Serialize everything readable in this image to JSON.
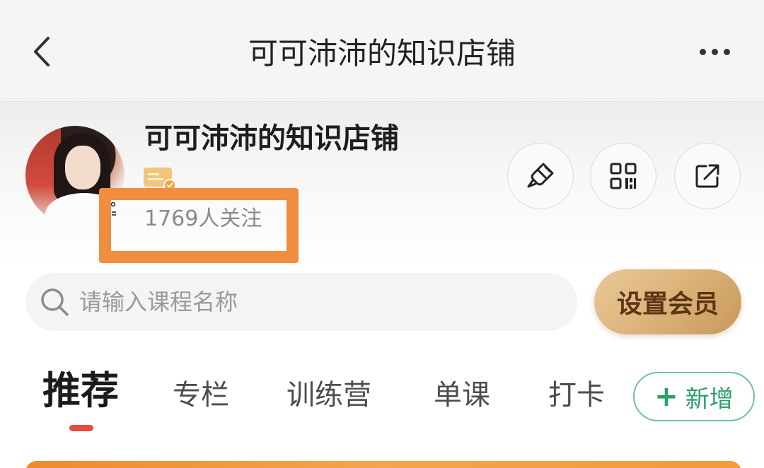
{
  "nav": {
    "title": "可可沛沛的知识店铺",
    "back_icon": "chevron-left-icon",
    "more_icon": "more-dots-icon"
  },
  "shop": {
    "name": "可可沛沛的知识店铺",
    "followers": "1769人关注",
    "verified_icon": "verified-card-icon",
    "actions": [
      {
        "name": "brush-icon"
      },
      {
        "name": "qr-code-icon"
      },
      {
        "name": "share-icon"
      }
    ]
  },
  "search": {
    "placeholder": "请输入课程名称",
    "icon": "search-icon"
  },
  "member_button": {
    "label": "设置会员"
  },
  "tabs": [
    {
      "label": "推荐",
      "active": true
    },
    {
      "label": "专栏",
      "active": false
    },
    {
      "label": "训练营",
      "active": false
    },
    {
      "label": "单课",
      "active": false
    },
    {
      "label": "打卡",
      "active": false
    }
  ],
  "add_tab": {
    "plus": "+",
    "label": "新增"
  },
  "colors": {
    "highlight": "#f08d3e",
    "tab_indicator": "#e84b40",
    "add_green": "#2f9e6a",
    "member_gold": "#dcb27a"
  }
}
